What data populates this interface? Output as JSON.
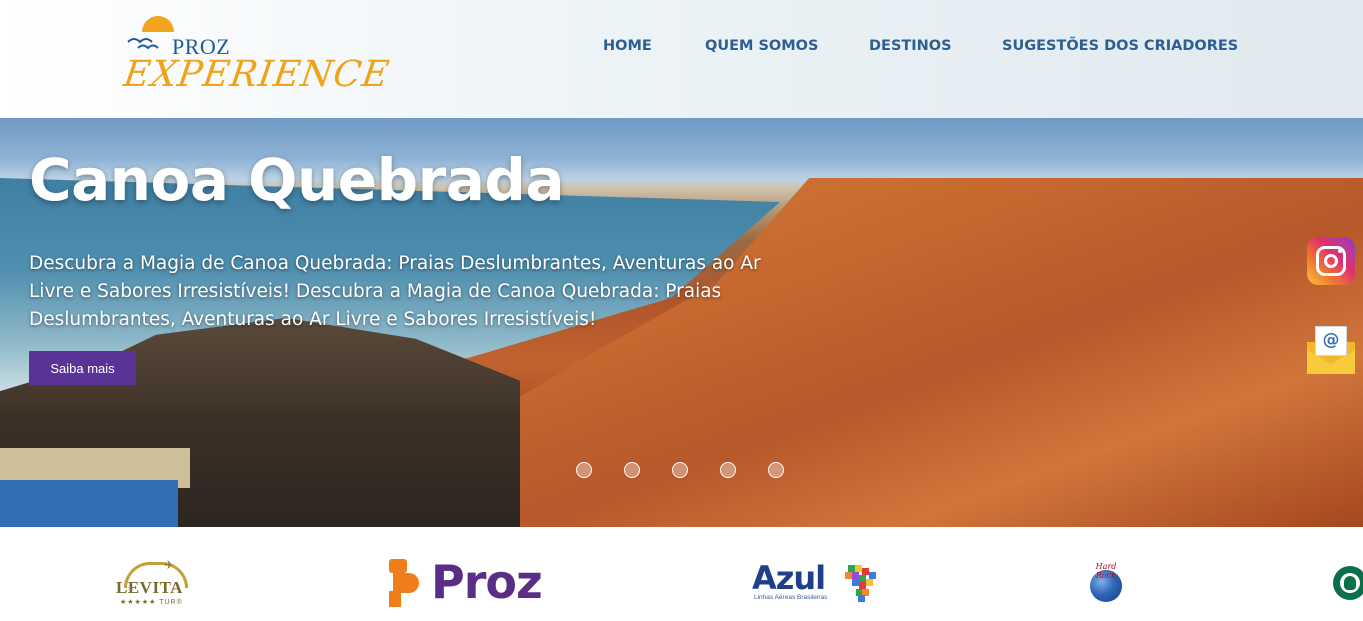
{
  "header": {
    "logo": {
      "brand_top": "PROZ",
      "brand_bottom": "EXPERIENCE"
    },
    "nav": {
      "home": "HOME",
      "about": "QUEM SOMOS",
      "destinations": "DESTINOS",
      "suggestions": "SUGESTÕES DOS CRIADORES"
    }
  },
  "hero": {
    "title": "Canoa Quebrada",
    "description": "Descubra a Magia de Canoa Quebrada: Praias Deslumbrantes, Aventuras ao Ar Livre e Sabores Irresistíveis! Descubra a Magia de Canoa Quebrada: Praias Deslumbrantes, Aventuras ao Ar Livre e Sabores Irresistíveis!",
    "cta": "Saiba mais",
    "slides_count": 5
  },
  "social": {
    "instagram_icon": "instagram-icon",
    "mail_icon": "email-icon",
    "mail_symbol": "@"
  },
  "partners": {
    "levita": {
      "name": "LEVITA",
      "sub": "★★★★★ TUR®"
    },
    "proz": {
      "name": "Proz"
    },
    "azul": {
      "name": "Azul",
      "sub": "Linhas Aéreas Brasileiras"
    },
    "hardrock": {
      "text": "Hard Rock"
    },
    "starbucks": {
      "icon": "starbucks-logo"
    }
  },
  "colors": {
    "nav_text": "#2e5f93",
    "cta_bg": "#5a3397",
    "brand_orange": "#f0a31a",
    "proz_purple": "#5a2d86",
    "proz_orange": "#ef7d1b",
    "azul_blue": "#1f3f8a"
  }
}
